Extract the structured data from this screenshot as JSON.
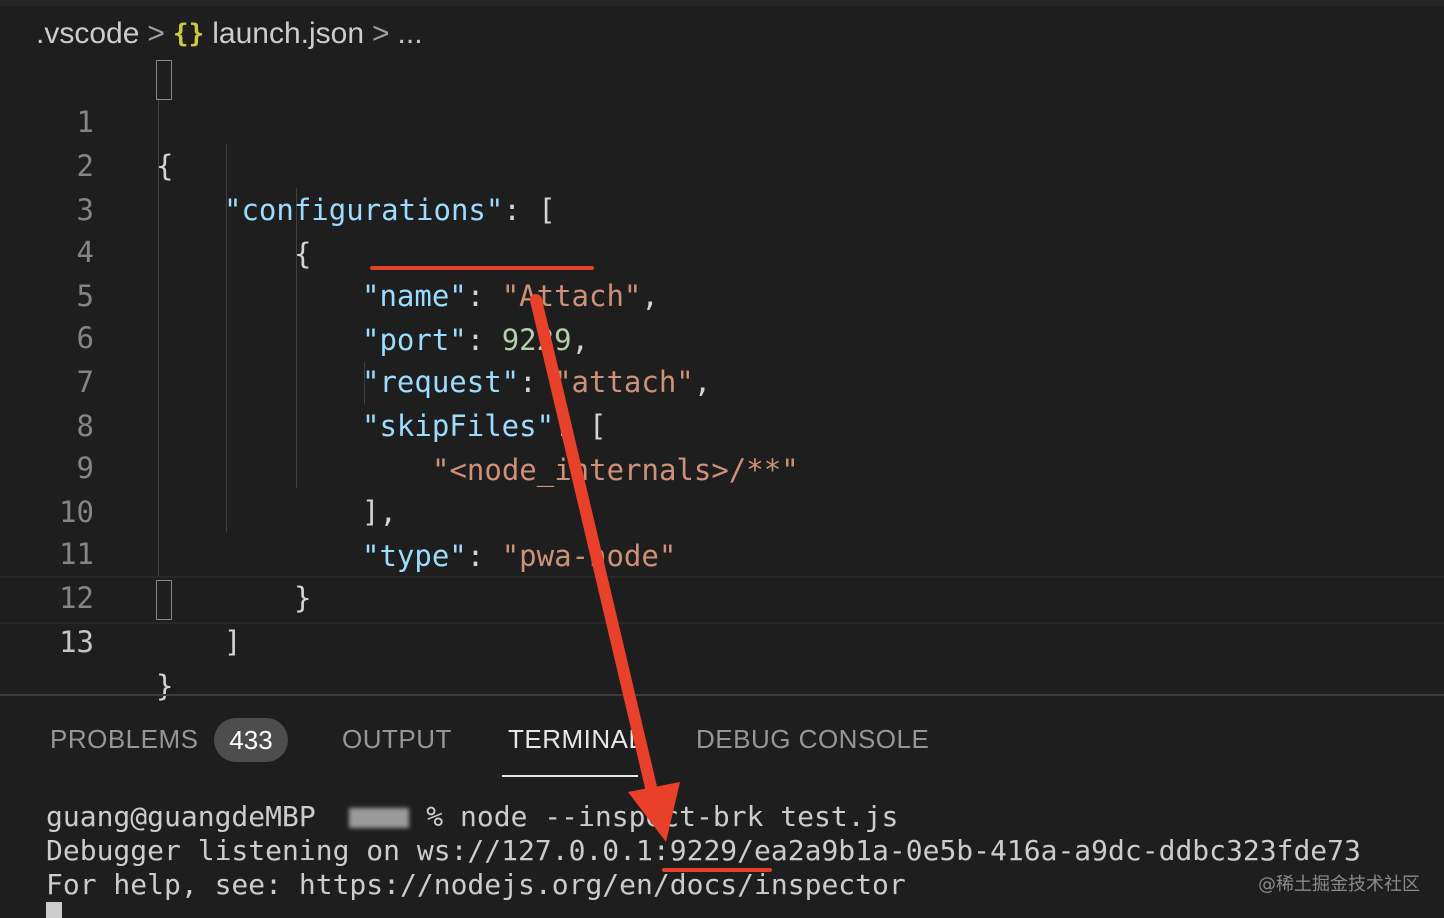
{
  "breadcrumb": {
    "folder": ".vscode",
    "sep": ">",
    "icon": "{}",
    "file": "launch.json",
    "ellipsis": "..."
  },
  "editor": {
    "lines": [
      {
        "n": "1",
        "text": "{"
      },
      {
        "n": "2",
        "text": "\"configurations\": ["
      },
      {
        "n": "3",
        "text": "{"
      },
      {
        "n": "4",
        "text": "\"name\": \"Attach\","
      },
      {
        "n": "5",
        "text": "\"port\": 9229,"
      },
      {
        "n": "6",
        "text": "\"request\": \"attach\","
      },
      {
        "n": "7",
        "text": "\"skipFiles\": ["
      },
      {
        "n": "8",
        "text": "\"<node_internals>/**\""
      },
      {
        "n": "9",
        "text": "],"
      },
      {
        "n": "10",
        "text": "\"type\": \"pwa-node\""
      },
      {
        "n": "11",
        "text": "}"
      },
      {
        "n": "12",
        "text": "]"
      },
      {
        "n": "13",
        "text": "}"
      }
    ],
    "tokens": {
      "l1": "{",
      "l2_key": "\"configurations\"",
      "l2_rest": ": [",
      "l3": "{",
      "l4_key": "\"name\"",
      "l4_colon": ": ",
      "l4_val": "\"Attach\"",
      "l4_comma": ",",
      "l5_key": "\"port\"",
      "l5_colon": ": ",
      "l5_val": "9229",
      "l5_comma": ",",
      "l6_key": "\"request\"",
      "l6_colon": ": ",
      "l6_val": "\"attach\"",
      "l6_comma": ",",
      "l7_key": "\"skipFiles\"",
      "l7_rest": ": [",
      "l8_val": "\"<node_internals>/**\"",
      "l9": "],",
      "l10_key": "\"type\"",
      "l10_colon": ": ",
      "l10_val": "\"pwa-node\"",
      "l11": "}",
      "l12": "]",
      "l13": "}"
    }
  },
  "panel": {
    "tabs": {
      "problems": "PROBLEMS",
      "problems_count": "433",
      "output": "OUTPUT",
      "terminal": "TERMINAL",
      "debug_console": "DEBUG CONSOLE"
    },
    "active_tab": "TERMINAL"
  },
  "terminal": {
    "line1_user": "guang@guangdeMBP",
    "line1_cmd": "% node --inspect-brk test.js",
    "line2": "Debugger listening on ws://127.0.0.1:9229/ea2a9b1a-0e5b-416a-a9dc-ddbc323fde73",
    "line3": "For help, see: https://nodejs.org/en/docs/inspector"
  },
  "watermark": "@稀土掘金技术社区",
  "colors": {
    "background": "#1e1e1e",
    "json_key": "#9cdcfe",
    "json_string": "#ce9178",
    "json_number": "#b5cea8",
    "annotation_red": "#e8402a"
  }
}
